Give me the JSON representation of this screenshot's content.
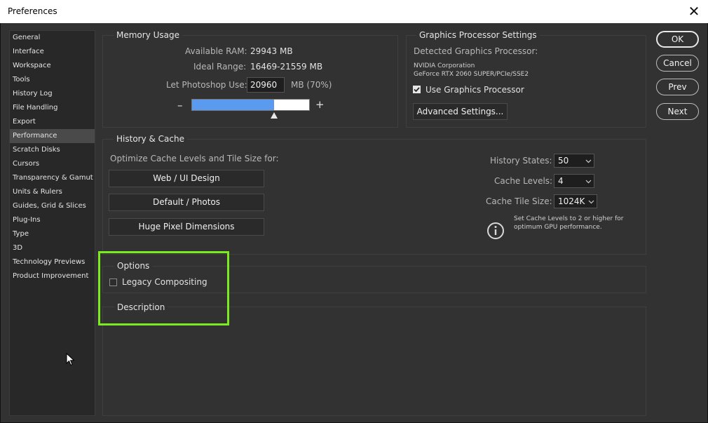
{
  "window": {
    "title": "Preferences",
    "close": "✕"
  },
  "sidebar": {
    "items": [
      {
        "label": "General"
      },
      {
        "label": "Interface"
      },
      {
        "label": "Workspace"
      },
      {
        "label": "Tools"
      },
      {
        "label": "History Log"
      },
      {
        "label": "File Handling"
      },
      {
        "label": "Export"
      },
      {
        "label": "Performance",
        "selected": true
      },
      {
        "label": "Scratch Disks"
      },
      {
        "label": "Cursors"
      },
      {
        "label": "Transparency & Gamut"
      },
      {
        "label": "Units & Rulers"
      },
      {
        "label": "Guides, Grid & Slices"
      },
      {
        "label": "Plug-Ins"
      },
      {
        "label": "Type"
      },
      {
        "label": "3D"
      },
      {
        "label": "Technology Previews"
      },
      {
        "label": "Product Improvement"
      }
    ]
  },
  "memory": {
    "group_label": "Memory Usage",
    "available_label": "Available RAM:",
    "available_value": "29943 MB",
    "ideal_label": "Ideal Range:",
    "ideal_value": "16469-21559 MB",
    "use_label": "Let Photoshop Use:",
    "use_value": "20960",
    "use_suffix": "MB (70%)",
    "minus": "–",
    "plus": "+",
    "slider_fraction": 0.7
  },
  "gpu": {
    "group_label": "Graphics Processor Settings",
    "detected_label": "Detected Graphics Processor:",
    "vendor": "NVIDIA Corporation",
    "model": "GeForce RTX 2060 SUPER/PCIe/SSE2",
    "use_gpu_label": "Use Graphics Processor",
    "use_gpu_checked": true,
    "advanced_button": "Advanced Settings..."
  },
  "history_cache": {
    "group_label": "History & Cache",
    "optimize_label": "Optimize Cache Levels and Tile Size for:",
    "buttons": [
      "Web / UI Design",
      "Default / Photos",
      "Huge Pixel Dimensions"
    ],
    "history_states_label": "History States:",
    "history_states_value": "50",
    "cache_levels_label": "Cache Levels:",
    "cache_levels_value": "4",
    "tile_size_label": "Cache Tile Size:",
    "tile_size_value": "1024K",
    "info_line1": "Set Cache Levels to 2 or higher for",
    "info_line2": "optimum GPU performance."
  },
  "options": {
    "group_label": "Options",
    "legacy_label": "Legacy Compositing",
    "legacy_checked": false
  },
  "description": {
    "group_label": "Description"
  },
  "actions": {
    "ok": "OK",
    "cancel": "Cancel",
    "prev": "Prev",
    "next": "Next"
  },
  "colors": {
    "highlight": "#7bea1f",
    "slider_fill": "#5b9bef"
  }
}
